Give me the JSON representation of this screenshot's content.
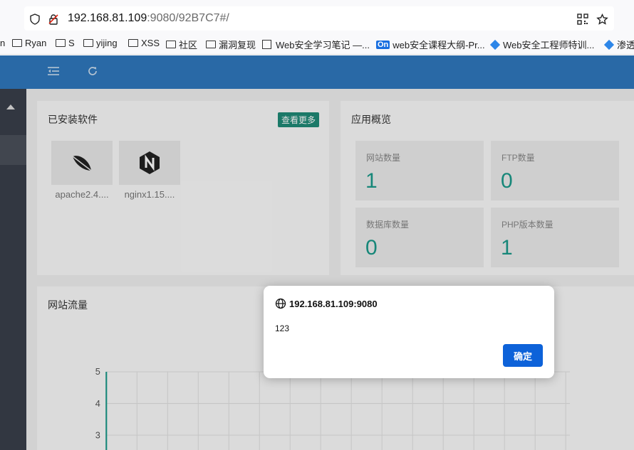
{
  "browser": {
    "url_host": "192.168.81.109",
    "url_rest": ":9080/92B7C7#/",
    "bookmarks": [
      "Ryan",
      "S",
      "yijing",
      "XSS",
      "社区",
      "漏洞复现",
      "Web安全学习笔记 —...",
      "web安全课程大纲-Pr...",
      "Web安全工程师特训...",
      "渗透"
    ],
    "bookmark_badge": "On",
    "bookmark_partial": "n"
  },
  "installed": {
    "title": "已安装软件",
    "more_label": "查看更多",
    "items": [
      {
        "name": "apache2.4....",
        "icon": "feather-icon"
      },
      {
        "name": "nginx1.15....",
        "icon": "nginx-icon"
      }
    ]
  },
  "overview": {
    "title": "应用概览",
    "stats": [
      {
        "label": "网站数量",
        "value": "1"
      },
      {
        "label": "FTP数量",
        "value": "0"
      },
      {
        "label": "数据库数量",
        "value": "0"
      },
      {
        "label": "PHP版本数量",
        "value": "1"
      }
    ]
  },
  "traffic": {
    "title": "网站流量",
    "y_ticks": [
      "5",
      "4",
      "3"
    ]
  },
  "chart_data": {
    "type": "line",
    "title": "网站流量",
    "y_ticks": [
      5,
      4,
      3
    ],
    "grid": true
  },
  "dialog": {
    "origin": "192.168.81.109:9080",
    "message": "123",
    "ok_label": "确定"
  },
  "colors": {
    "accent": "#2f78be",
    "teal": "#1b9a8a",
    "dialog_button": "#0d62d9"
  }
}
